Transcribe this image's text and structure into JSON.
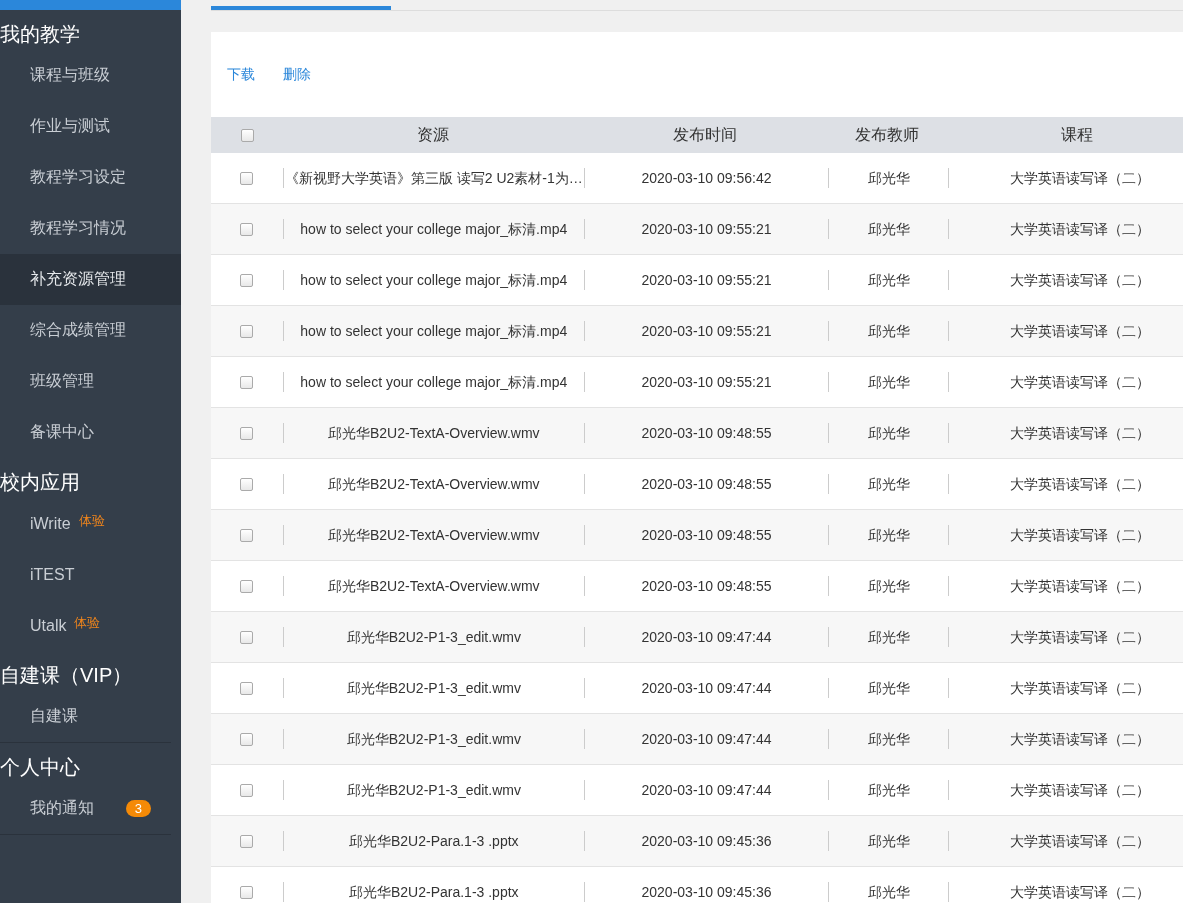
{
  "sidebar": {
    "sections": [
      {
        "title": "我的教学",
        "items": [
          {
            "label": "课程与班级",
            "selected": false
          },
          {
            "label": "作业与测试",
            "selected": false
          },
          {
            "label": "教程学习设定",
            "selected": false
          },
          {
            "label": "教程学习情况",
            "selected": false
          },
          {
            "label": "补充资源管理",
            "selected": true
          },
          {
            "label": "综合成绩管理",
            "selected": false
          },
          {
            "label": "班级管理",
            "selected": false
          },
          {
            "label": "备课中心",
            "selected": false
          }
        ]
      },
      {
        "title": "校内应用",
        "items": [
          {
            "label": "iWrite",
            "selected": false,
            "tag": "体验"
          },
          {
            "label": "iTEST",
            "selected": false
          },
          {
            "label": "Utalk",
            "selected": false,
            "tag": "体验"
          }
        ]
      },
      {
        "title": "自建课（VIP）",
        "items": [
          {
            "label": "自建课",
            "selected": false
          }
        ]
      },
      {
        "title": "个人中心",
        "items": [
          {
            "label": "我的通知",
            "selected": false,
            "badge": "3"
          }
        ]
      }
    ]
  },
  "actions": [
    "下载",
    "删除"
  ],
  "table": {
    "header_checked": false,
    "columns": [
      "资源",
      "发布时间",
      "发布教师",
      "课程"
    ],
    "rows": [
      {
        "checked": false,
        "cells": [
          "《新视野大学英语》第三版 读写2 U2素材-1为…",
          "2020-03-10 09:56:42",
          "邱光华",
          "大学英语读写译（二）"
        ]
      },
      {
        "checked": false,
        "cells": [
          "how to select your college major_标清.mp4",
          "2020-03-10 09:55:21",
          "邱光华",
          "大学英语读写译（二）"
        ]
      },
      {
        "checked": false,
        "cells": [
          "how to select your college major_标清.mp4",
          "2020-03-10 09:55:21",
          "邱光华",
          "大学英语读写译（二）"
        ]
      },
      {
        "checked": false,
        "cells": [
          "how to select your college major_标清.mp4",
          "2020-03-10 09:55:21",
          "邱光华",
          "大学英语读写译（二）"
        ]
      },
      {
        "checked": false,
        "cells": [
          "how to select your college major_标清.mp4",
          "2020-03-10 09:55:21",
          "邱光华",
          "大学英语读写译（二）"
        ]
      },
      {
        "checked": false,
        "cells": [
          "邱光华B2U2-TextA-Overview.wmv",
          "2020-03-10 09:48:55",
          "邱光华",
          "大学英语读写译（二）"
        ]
      },
      {
        "checked": false,
        "cells": [
          "邱光华B2U2-TextA-Overview.wmv",
          "2020-03-10 09:48:55",
          "邱光华",
          "大学英语读写译（二）"
        ]
      },
      {
        "checked": false,
        "cells": [
          "邱光华B2U2-TextA-Overview.wmv",
          "2020-03-10 09:48:55",
          "邱光华",
          "大学英语读写译（二）"
        ]
      },
      {
        "checked": false,
        "cells": [
          "邱光华B2U2-TextA-Overview.wmv",
          "2020-03-10 09:48:55",
          "邱光华",
          "大学英语读写译（二）"
        ]
      },
      {
        "checked": false,
        "cells": [
          "邱光华B2U2-P1-3_edit.wmv",
          "2020-03-10 09:47:44",
          "邱光华",
          "大学英语读写译（二）"
        ]
      },
      {
        "checked": false,
        "cells": [
          "邱光华B2U2-P1-3_edit.wmv",
          "2020-03-10 09:47:44",
          "邱光华",
          "大学英语读写译（二）"
        ]
      },
      {
        "checked": false,
        "cells": [
          "邱光华B2U2-P1-3_edit.wmv",
          "2020-03-10 09:47:44",
          "邱光华",
          "大学英语读写译（二）"
        ]
      },
      {
        "checked": false,
        "cells": [
          "邱光华B2U2-P1-3_edit.wmv",
          "2020-03-10 09:47:44",
          "邱光华",
          "大学英语读写译（二）"
        ]
      },
      {
        "checked": false,
        "cells": [
          "邱光华B2U2-Para.1-3 .pptx",
          "2020-03-10 09:45:36",
          "邱光华",
          "大学英语读写译（二）"
        ]
      },
      {
        "checked": false,
        "cells": [
          "邱光华B2U2-Para.1-3 .pptx",
          "2020-03-10 09:45:36",
          "邱光华",
          "大学英语读写译（二）"
        ]
      }
    ]
  }
}
